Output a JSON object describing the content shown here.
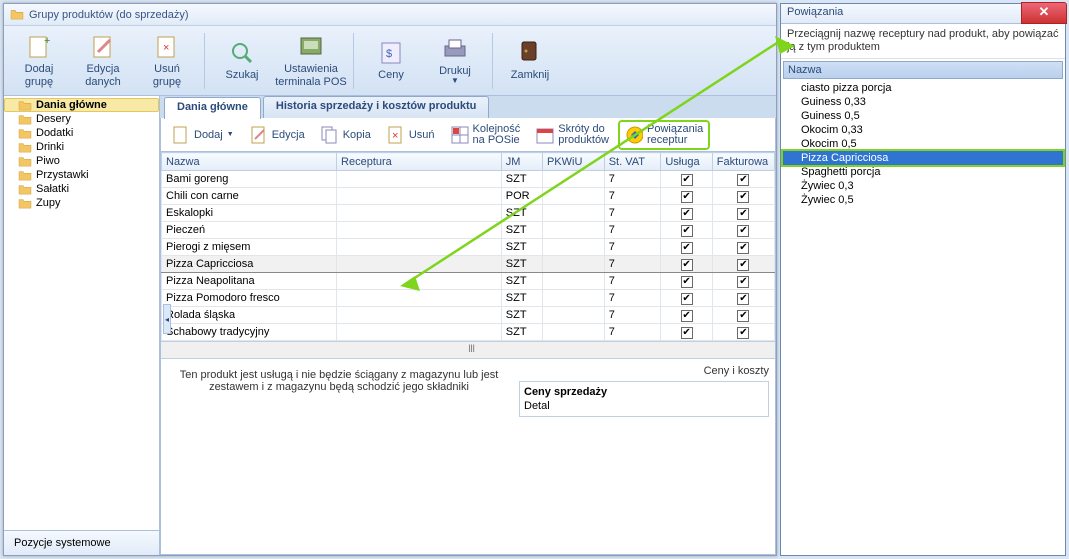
{
  "window": {
    "title": "Grupy produktów (do sprzedaży)"
  },
  "ribbon": {
    "add_group": "Dodaj\ngrupę",
    "edit_data": "Edycja\ndanych",
    "del_group": "Usuń\ngrupę",
    "search": "Szukaj",
    "pos_settings": "Ustawienia\nterminala POS",
    "prices": "Ceny",
    "print": "Drukuj",
    "close": "Zamknij"
  },
  "tree": {
    "items": [
      "Dania główne",
      "Desery",
      "Dodatki",
      "Drinki",
      "Piwo",
      "Przystawki",
      "Sałatki",
      "Zupy"
    ],
    "selected_index": 0,
    "system_positions": "Pozycje systemowe"
  },
  "tabs": {
    "main": "Dania główne",
    "history": "Historia sprzedaży i kosztów produktu"
  },
  "toolbar2": {
    "add": "Dodaj",
    "edit": "Edycja",
    "copy": "Kopia",
    "delete": "Usuń",
    "pos_order_l1": "Kolejność",
    "pos_order_l2": "na POSie",
    "shortcuts_l1": "Skróty do",
    "shortcuts_l2": "produktów",
    "recipes_l1": "Powiązania",
    "recipes_l2": "receptur"
  },
  "grid": {
    "cols": [
      "Nazwa",
      "Receptura",
      "JM",
      "PKWiU",
      "St. VAT",
      "Usługa",
      "Fakturowa"
    ],
    "rows": [
      {
        "n": "Bami goreng",
        "jm": "SZT",
        "vat": "7",
        "u": true,
        "f": true
      },
      {
        "n": "Chili con carne",
        "jm": "POR",
        "vat": "7",
        "u": true,
        "f": true
      },
      {
        "n": "Eskalopki",
        "jm": "SZT",
        "vat": "7",
        "u": true,
        "f": true
      },
      {
        "n": "Pieczeń",
        "jm": "SZT",
        "vat": "7",
        "u": true,
        "f": true
      },
      {
        "n": "Pierogi z mięsem",
        "jm": "SZT",
        "vat": "7",
        "u": true,
        "f": true
      },
      {
        "n": "Pizza Capricciosa",
        "jm": "SZT",
        "vat": "7",
        "u": true,
        "f": true,
        "sel": true
      },
      {
        "n": "Pizza Neapolitana",
        "jm": "SZT",
        "vat": "7",
        "u": true,
        "f": true
      },
      {
        "n": "Pizza Pomodoro fresco",
        "jm": "SZT",
        "vat": "7",
        "u": true,
        "f": true
      },
      {
        "n": "Rolada śląska",
        "jm": "SZT",
        "vat": "7",
        "u": true,
        "f": true
      },
      {
        "n": "Schabowy tradycyjny",
        "jm": "SZT",
        "vat": "7",
        "u": true,
        "f": true
      }
    ]
  },
  "footer": {
    "info": "Ten produkt jest usługą i nie będzie ściągany z magazynu lub jest zestawem i z magazynu będą schodzić jego składniki",
    "prices_cost": "Ceny i koszty",
    "sale_prices": "Ceny sprzedaży",
    "detail": "Detal"
  },
  "panel": {
    "title": "Powiązania",
    "hint": "Przeciągnij nazwę receptury nad produkt, aby powiązać ją z tym produktem",
    "list_header": "Nazwa",
    "items": [
      "ciasto pizza porcja",
      "Guiness 0,33",
      "Guiness 0,5",
      "Okocim 0,33",
      "Okocim 0,5",
      "Pizza Capricciosa",
      "Spaghetti porcja",
      "Żywiec 0,3",
      "Żywiec 0,5"
    ],
    "selected_index": 5
  }
}
